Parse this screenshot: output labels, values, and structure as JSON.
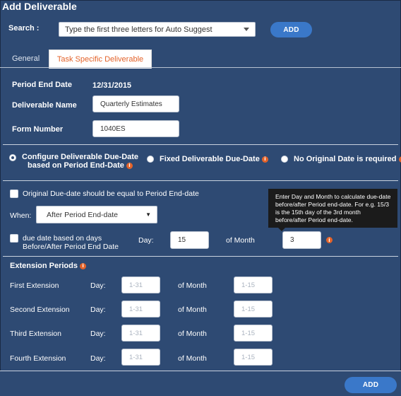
{
  "window": {
    "title": "Add Deliverable"
  },
  "search": {
    "label": "Search :",
    "placeholder": "Type the first three letters for Auto Suggest",
    "add_label": "ADD"
  },
  "tabs": [
    {
      "label": "General"
    },
    {
      "label": "Task Specific Deliverable",
      "active": true
    }
  ],
  "form": {
    "period_end_label": "Period End Date",
    "period_end_value": "12/31/2015",
    "deliverable_name_label": "Deliverable Name",
    "deliverable_name_value": "Quarterly Estimates",
    "form_number_label": "Form Number",
    "form_number_value": "1040ES"
  },
  "due_options": {
    "option1_line1": "Configure Deliverable Due-Date",
    "option1_line2": "based on Period End-Date",
    "option2": "Fixed Deliverable Due-Date",
    "option3": "No Original Date is required",
    "selected": "option1"
  },
  "due_config": {
    "equal_check_label": "Original Due-date should be equal to Period End-date",
    "when_label": "When:",
    "when_value": "After Period End-date",
    "days_check_line1": "due date based on days",
    "days_check_line2": "Before/After Period End Date",
    "day_label": "Day:",
    "day_value": "15",
    "of_month_label": "of Month",
    "month_value": "3",
    "tooltip": "Enter Day and Month to calculate due-date before/after Period end-date. For e.g. 15/3 is the 15th day of the 3rd month before/after Period end-date."
  },
  "extensions": {
    "heading": "Extension Periods",
    "day_label": "Day:",
    "of_month_label": "of Month",
    "day_placeholder": "1-31",
    "month_placeholder": "1-15",
    "rows": [
      {
        "label": "First Extension"
      },
      {
        "label": "Second Extension"
      },
      {
        "label": "Third Extension"
      },
      {
        "label": "Fourth Extension"
      }
    ]
  },
  "footer": {
    "add_label": "ADD"
  },
  "colors": {
    "background": "#2e4a73",
    "accent": "#3a78c9",
    "tab_active_text": "#e3632a",
    "info_icon": "#e3632a"
  },
  "icons": {
    "info": "info-icon",
    "dropdown": "chevron-down-icon"
  }
}
